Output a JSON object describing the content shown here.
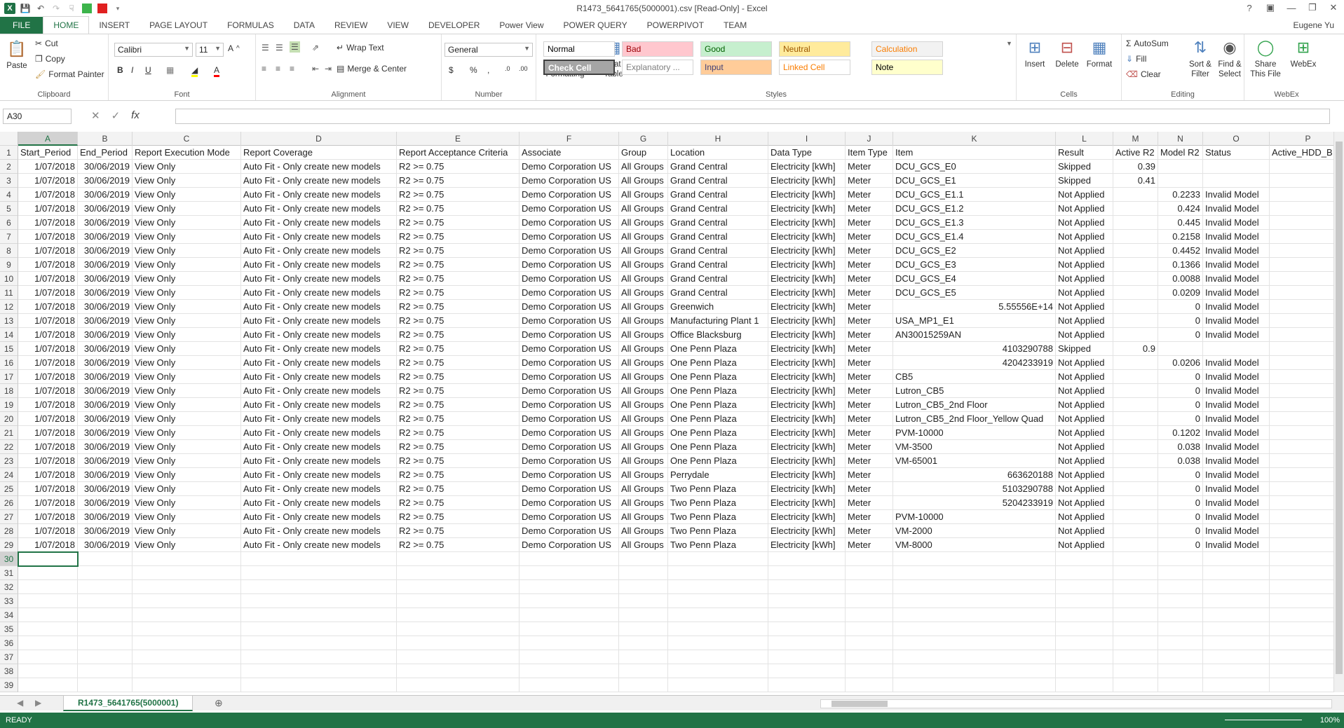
{
  "window": {
    "title": "R1473_5641765(5000001).csv  [Read-Only] - Excel",
    "user": "Eugene Yu"
  },
  "tabs": [
    "FILE",
    "HOME",
    "INSERT",
    "PAGE LAYOUT",
    "FORMULAS",
    "DATA",
    "REVIEW",
    "VIEW",
    "DEVELOPER",
    "Power View",
    "POWER QUERY",
    "POWERPIVOT",
    "TEAM"
  ],
  "ribbon": {
    "clipboard": {
      "paste": "Paste",
      "cut": "Cut",
      "copy": "Copy",
      "format_painter": "Format Painter",
      "label": "Clipboard"
    },
    "font": {
      "name": "Calibri",
      "size": "11",
      "label": "Font"
    },
    "alignment": {
      "wrap": "Wrap Text",
      "merge": "Merge & Center",
      "label": "Alignment"
    },
    "number": {
      "format": "General",
      "label": "Number"
    },
    "styles": {
      "conditional": "Conditional Formatting",
      "format_table": "Format as Table",
      "cells": [
        {
          "name": "Normal",
          "bg": "#ffffff",
          "fg": "#000000"
        },
        {
          "name": "Bad",
          "bg": "#ffc7ce",
          "fg": "#9c0006"
        },
        {
          "name": "Good",
          "bg": "#c6efce",
          "fg": "#006100"
        },
        {
          "name": "Neutral",
          "bg": "#ffeb9c",
          "fg": "#9c5700"
        },
        {
          "name": "Calculation",
          "bg": "#f2f2f2",
          "fg": "#fa7d00"
        },
        {
          "name": "Check Cell",
          "bg": "#a5a5a5",
          "fg": "#ffffff"
        },
        {
          "name": "Explanatory ...",
          "bg": "#ffffff",
          "fg": "#7f7f7f"
        },
        {
          "name": "Input",
          "bg": "#ffcc99",
          "fg": "#3f3f76"
        },
        {
          "name": "Linked Cell",
          "bg": "#ffffff",
          "fg": "#fa7d00"
        },
        {
          "name": "Note",
          "bg": "#ffffcc",
          "fg": "#000000"
        }
      ],
      "label": "Styles"
    },
    "cells": {
      "insert": "Insert",
      "delete": "Delete",
      "format": "Format",
      "label": "Cells"
    },
    "editing": {
      "autosum": "AutoSum",
      "fill": "Fill",
      "clear": "Clear",
      "sort": "Sort & Filter",
      "find": "Find & Select",
      "label": "Editing"
    },
    "webex": {
      "share": "Share This File",
      "webex": "WebEx",
      "label": "WebEx"
    }
  },
  "formula_bar": {
    "name_box": "A30",
    "content": ""
  },
  "columns": [
    "A",
    "B",
    "C",
    "D",
    "E",
    "F",
    "G",
    "H",
    "I",
    "J",
    "K",
    "L",
    "M",
    "N",
    "O",
    "P"
  ],
  "header_row": [
    "Start_Period",
    "End_Period",
    "Report Execution Mode",
    "Report Coverage",
    "Report Acceptance Criteria",
    "Associate",
    "Group",
    "Location",
    "Data Type",
    "Item Type",
    "Item",
    "Result",
    "Active R2",
    "Model R2",
    "Status",
    "Active_HDD_B"
  ],
  "rows": [
    [
      "1/07/2018",
      "30/06/2019",
      "View Only",
      "Auto Fit - Only create new models",
      "R2 >= 0.75",
      "Demo Corporation US",
      "All Groups",
      "Grand Central",
      "Electricity [kWh]",
      "Meter",
      "DCU_GCS_E0",
      "Skipped",
      "0.39",
      "",
      "",
      ""
    ],
    [
      "1/07/2018",
      "30/06/2019",
      "View Only",
      "Auto Fit - Only create new models",
      "R2 >= 0.75",
      "Demo Corporation US",
      "All Groups",
      "Grand Central",
      "Electricity [kWh]",
      "Meter",
      "DCU_GCS_E1",
      "Skipped",
      "0.41",
      "",
      "",
      ""
    ],
    [
      "1/07/2018",
      "30/06/2019",
      "View Only",
      "Auto Fit - Only create new models",
      "R2 >= 0.75",
      "Demo Corporation US",
      "All Groups",
      "Grand Central",
      "Electricity [kWh]",
      "Meter",
      "DCU_GCS_E1.1",
      "Not Applied",
      "",
      "0.2233",
      "Invalid Model",
      ""
    ],
    [
      "1/07/2018",
      "30/06/2019",
      "View Only",
      "Auto Fit - Only create new models",
      "R2 >= 0.75",
      "Demo Corporation US",
      "All Groups",
      "Grand Central",
      "Electricity [kWh]",
      "Meter",
      "DCU_GCS_E1.2",
      "Not Applied",
      "",
      "0.424",
      "Invalid Model",
      ""
    ],
    [
      "1/07/2018",
      "30/06/2019",
      "View Only",
      "Auto Fit - Only create new models",
      "R2 >= 0.75",
      "Demo Corporation US",
      "All Groups",
      "Grand Central",
      "Electricity [kWh]",
      "Meter",
      "DCU_GCS_E1.3",
      "Not Applied",
      "",
      "0.445",
      "Invalid Model",
      ""
    ],
    [
      "1/07/2018",
      "30/06/2019",
      "View Only",
      "Auto Fit - Only create new models",
      "R2 >= 0.75",
      "Demo Corporation US",
      "All Groups",
      "Grand Central",
      "Electricity [kWh]",
      "Meter",
      "DCU_GCS_E1.4",
      "Not Applied",
      "",
      "0.2158",
      "Invalid Model",
      ""
    ],
    [
      "1/07/2018",
      "30/06/2019",
      "View Only",
      "Auto Fit - Only create new models",
      "R2 >= 0.75",
      "Demo Corporation US",
      "All Groups",
      "Grand Central",
      "Electricity [kWh]",
      "Meter",
      "DCU_GCS_E2",
      "Not Applied",
      "",
      "0.4452",
      "Invalid Model",
      ""
    ],
    [
      "1/07/2018",
      "30/06/2019",
      "View Only",
      "Auto Fit - Only create new models",
      "R2 >= 0.75",
      "Demo Corporation US",
      "All Groups",
      "Grand Central",
      "Electricity [kWh]",
      "Meter",
      "DCU_GCS_E3",
      "Not Applied",
      "",
      "0.1366",
      "Invalid Model",
      ""
    ],
    [
      "1/07/2018",
      "30/06/2019",
      "View Only",
      "Auto Fit - Only create new models",
      "R2 >= 0.75",
      "Demo Corporation US",
      "All Groups",
      "Grand Central",
      "Electricity [kWh]",
      "Meter",
      "DCU_GCS_E4",
      "Not Applied",
      "",
      "0.0088",
      "Invalid Model",
      ""
    ],
    [
      "1/07/2018",
      "30/06/2019",
      "View Only",
      "Auto Fit - Only create new models",
      "R2 >= 0.75",
      "Demo Corporation US",
      "All Groups",
      "Grand Central",
      "Electricity [kWh]",
      "Meter",
      "DCU_GCS_E5",
      "Not Applied",
      "",
      "0.0209",
      "Invalid Model",
      ""
    ],
    [
      "1/07/2018",
      "30/06/2019",
      "View Only",
      "Auto Fit - Only create new models",
      "R2 >= 0.75",
      "Demo Corporation US",
      "All Groups",
      "Greenwich",
      "Electricity [kWh]",
      "Meter",
      "5.55556E+14",
      "Not Applied",
      "",
      "0",
      "Invalid Model",
      ""
    ],
    [
      "1/07/2018",
      "30/06/2019",
      "View Only",
      "Auto Fit - Only create new models",
      "R2 >= 0.75",
      "Demo Corporation US",
      "All Groups",
      "Manufacturing Plant 1",
      "Electricity [kWh]",
      "Meter",
      "USA_MP1_E1",
      "Not Applied",
      "",
      "0",
      "Invalid Model",
      ""
    ],
    [
      "1/07/2018",
      "30/06/2019",
      "View Only",
      "Auto Fit - Only create new models",
      "R2 >= 0.75",
      "Demo Corporation US",
      "All Groups",
      "Office Blacksburg",
      "Electricity [kWh]",
      "Meter",
      "AN30015259AN",
      "Not Applied",
      "",
      "0",
      "Invalid Model",
      ""
    ],
    [
      "1/07/2018",
      "30/06/2019",
      "View Only",
      "Auto Fit - Only create new models",
      "R2 >= 0.75",
      "Demo Corporation US",
      "All Groups",
      "One Penn Plaza",
      "Electricity [kWh]",
      "Meter",
      "4103290788",
      "Skipped",
      "0.9",
      "",
      "",
      ""
    ],
    [
      "1/07/2018",
      "30/06/2019",
      "View Only",
      "Auto Fit - Only create new models",
      "R2 >= 0.75",
      "Demo Corporation US",
      "All Groups",
      "One Penn Plaza",
      "Electricity [kWh]",
      "Meter",
      "4204233919",
      "Not Applied",
      "",
      "0.0206",
      "Invalid Model",
      ""
    ],
    [
      "1/07/2018",
      "30/06/2019",
      "View Only",
      "Auto Fit - Only create new models",
      "R2 >= 0.75",
      "Demo Corporation US",
      "All Groups",
      "One Penn Plaza",
      "Electricity [kWh]",
      "Meter",
      "CB5",
      "Not Applied",
      "",
      "0",
      "Invalid Model",
      ""
    ],
    [
      "1/07/2018",
      "30/06/2019",
      "View Only",
      "Auto Fit - Only create new models",
      "R2 >= 0.75",
      "Demo Corporation US",
      "All Groups",
      "One Penn Plaza",
      "Electricity [kWh]",
      "Meter",
      "Lutron_CB5",
      "Not Applied",
      "",
      "0",
      "Invalid Model",
      ""
    ],
    [
      "1/07/2018",
      "30/06/2019",
      "View Only",
      "Auto Fit - Only create new models",
      "R2 >= 0.75",
      "Demo Corporation US",
      "All Groups",
      "One Penn Plaza",
      "Electricity [kWh]",
      "Meter",
      "Lutron_CB5_2nd Floor",
      "Not Applied",
      "",
      "0",
      "Invalid Model",
      ""
    ],
    [
      "1/07/2018",
      "30/06/2019",
      "View Only",
      "Auto Fit - Only create new models",
      "R2 >= 0.75",
      "Demo Corporation US",
      "All Groups",
      "One Penn Plaza",
      "Electricity [kWh]",
      "Meter",
      "Lutron_CB5_2nd Floor_Yellow Quad",
      "Not Applied",
      "",
      "0",
      "Invalid Model",
      ""
    ],
    [
      "1/07/2018",
      "30/06/2019",
      "View Only",
      "Auto Fit - Only create new models",
      "R2 >= 0.75",
      "Demo Corporation US",
      "All Groups",
      "One Penn Plaza",
      "Electricity [kWh]",
      "Meter",
      "PVM-10000",
      "Not Applied",
      "",
      "0.1202",
      "Invalid Model",
      ""
    ],
    [
      "1/07/2018",
      "30/06/2019",
      "View Only",
      "Auto Fit - Only create new models",
      "R2 >= 0.75",
      "Demo Corporation US",
      "All Groups",
      "One Penn Plaza",
      "Electricity [kWh]",
      "Meter",
      "VM-3500",
      "Not Applied",
      "",
      "0.038",
      "Invalid Model",
      ""
    ],
    [
      "1/07/2018",
      "30/06/2019",
      "View Only",
      "Auto Fit - Only create new models",
      "R2 >= 0.75",
      "Demo Corporation US",
      "All Groups",
      "One Penn Plaza",
      "Electricity [kWh]",
      "Meter",
      "VM-65001",
      "Not Applied",
      "",
      "0.038",
      "Invalid Model",
      ""
    ],
    [
      "1/07/2018",
      "30/06/2019",
      "View Only",
      "Auto Fit - Only create new models",
      "R2 >= 0.75",
      "Demo Corporation US",
      "All Groups",
      "Perrydale",
      "Electricity [kWh]",
      "Meter",
      "663620188",
      "Not Applied",
      "",
      "0",
      "Invalid Model",
      ""
    ],
    [
      "1/07/2018",
      "30/06/2019",
      "View Only",
      "Auto Fit - Only create new models",
      "R2 >= 0.75",
      "Demo Corporation US",
      "All Groups",
      "Two Penn Plaza",
      "Electricity [kWh]",
      "Meter",
      "5103290788",
      "Not Applied",
      "",
      "0",
      "Invalid Model",
      ""
    ],
    [
      "1/07/2018",
      "30/06/2019",
      "View Only",
      "Auto Fit - Only create new models",
      "R2 >= 0.75",
      "Demo Corporation US",
      "All Groups",
      "Two Penn Plaza",
      "Electricity [kWh]",
      "Meter",
      "5204233919",
      "Not Applied",
      "",
      "0",
      "Invalid Model",
      ""
    ],
    [
      "1/07/2018",
      "30/06/2019",
      "View Only",
      "Auto Fit - Only create new models",
      "R2 >= 0.75",
      "Demo Corporation US",
      "All Groups",
      "Two Penn Plaza",
      "Electricity [kWh]",
      "Meter",
      "PVM-10000",
      "Not Applied",
      "",
      "0",
      "Invalid Model",
      ""
    ],
    [
      "1/07/2018",
      "30/06/2019",
      "View Only",
      "Auto Fit - Only create new models",
      "R2 >= 0.75",
      "Demo Corporation US",
      "All Groups",
      "Two Penn Plaza",
      "Electricity [kWh]",
      "Meter",
      "VM-2000",
      "Not Applied",
      "",
      "0",
      "Invalid Model",
      ""
    ],
    [
      "1/07/2018",
      "30/06/2019",
      "View Only",
      "Auto Fit - Only create new models",
      "R2 >= 0.75",
      "Demo Corporation US",
      "All Groups",
      "Two Penn Plaza",
      "Electricity [kWh]",
      "Meter",
      "VM-8000",
      "Not Applied",
      "",
      "0",
      "Invalid Model",
      ""
    ]
  ],
  "numeric_columns": [
    0,
    1,
    12,
    13
  ],
  "row_numbers": [
    "1",
    "2",
    "3",
    "4",
    "5",
    "6",
    "7",
    "8",
    "9",
    "10",
    "11",
    "12",
    "13",
    "14",
    "15",
    "16",
    "17",
    "18",
    "19",
    "20",
    "21",
    "22",
    "23",
    "24",
    "25",
    "26",
    "27",
    "28",
    "29",
    "30",
    "31",
    "32",
    "33",
    "34",
    "35",
    "36",
    "37",
    "38",
    "39"
  ],
  "selected_row": "30",
  "selected_col": "A",
  "sheet_tab": "R1473_5641765(5000001)",
  "status": {
    "ready": "READY",
    "zoom": "100%"
  },
  "colors": {
    "accent": "#217346"
  }
}
